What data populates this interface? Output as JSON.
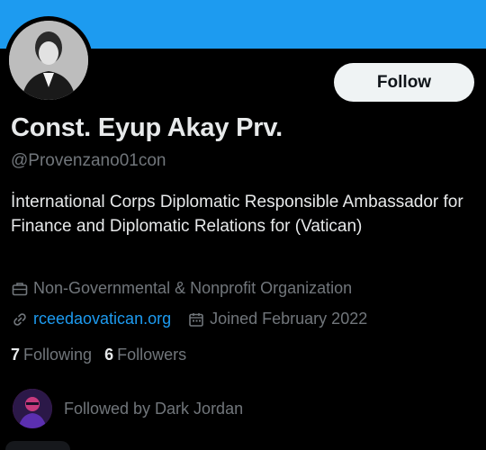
{
  "profile": {
    "display_name": "Const. Eyup Akay Prv.",
    "handle": "@Provenzano01con",
    "bio": "İnternational Corps Diplomatic Responsible Ambassador for Finance and Diplomatic Relations for (Vatican)",
    "category": "Non-Governmental & Nonprofit Organization",
    "website": "rceedaovatican.org",
    "joined": "Joined February 2022",
    "following_count": "7",
    "following_label": "Following",
    "followers_count": "6",
    "followers_label": "Followers",
    "followed_by": "Followed by Dark Jordan"
  },
  "actions": {
    "follow_label": "Follow"
  },
  "icons": {
    "category": "briefcase-icon",
    "website": "link-icon",
    "joined": "calendar-icon"
  },
  "colors": {
    "banner": "#1d9bf0",
    "link": "#1d9bf0",
    "muted": "#71767b",
    "background": "#000000"
  }
}
